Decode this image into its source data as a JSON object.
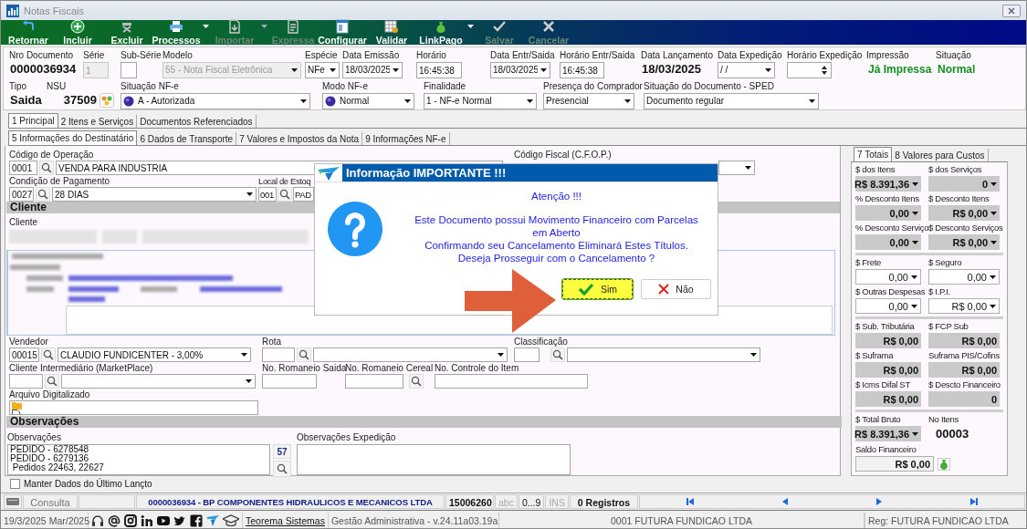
{
  "window": {
    "title": "Notas Fiscais"
  },
  "toolbar": [
    {
      "label": "Retornar",
      "disabled": false,
      "dropdown": false
    },
    {
      "label": "Incluir",
      "disabled": false,
      "dropdown": false
    },
    {
      "label": "Excluir",
      "disabled": false,
      "dropdown": false
    },
    {
      "label": "Processos",
      "disabled": false,
      "dropdown": true
    },
    {
      "label": "Importar",
      "disabled": true,
      "dropdown": true
    },
    {
      "label": "Expressa",
      "disabled": true,
      "dropdown": false
    },
    {
      "label": "Configurar",
      "disabled": false,
      "dropdown": false
    },
    {
      "label": "Validar",
      "disabled": false,
      "dropdown": false
    },
    {
      "label": "LinkPago",
      "disabled": false,
      "dropdown": true
    },
    {
      "label": "Salvar",
      "disabled": true,
      "dropdown": false
    },
    {
      "label": "Cancelar",
      "disabled": true,
      "dropdown": false
    }
  ],
  "header_top": [
    {
      "label": "Nro Documento",
      "value": "0000036934",
      "kind": "static",
      "disabled": false
    },
    {
      "label": "Série",
      "value": "1",
      "kind": "text",
      "disabled": true
    },
    {
      "label": "Sub-Série",
      "kind": "text",
      "disabled": false
    },
    {
      "label": "Modelo",
      "value": "55 - Nota Fiscal Eletrônica",
      "kind": "combo",
      "disabled": true
    },
    {
      "label": "Espécie",
      "value": "NFe",
      "kind": "combo",
      "disabled": false
    },
    {
      "label": "Data Emissão",
      "value": "18/03/2025",
      "kind": "combo",
      "disabled": false
    },
    {
      "label": "Horário",
      "value": "16:45:38",
      "kind": "text",
      "disabled": false
    },
    {
      "label": "Data Entr/Saida",
      "value": "18/03/2025",
      "kind": "combo",
      "disabled": false
    },
    {
      "label": "Horário Entr/Saida",
      "value": "16:45:38",
      "kind": "text",
      "disabled": false
    },
    {
      "label": "Data Lançamento",
      "value": "18/03/2025",
      "kind": "static",
      "disabled": false
    },
    {
      "label": "Data Expedição",
      "value": " / /",
      "kind": "combo",
      "disabled": false
    },
    {
      "label": "Horário Expedição",
      "kind": "spin",
      "disabled": false
    },
    {
      "label": "Impressão",
      "value": "Já Impressa",
      "kind": "status",
      "disabled": false
    },
    {
      "label": "Situação",
      "value": "Normal",
      "kind": "status",
      "disabled": false
    }
  ],
  "header_bottom": [
    {
      "label": "Tipo",
      "value": "Saida",
      "kind": "static",
      "disabled": false
    },
    {
      "label": "NSU",
      "value": "37509",
      "kind": "nsu",
      "disabled": false
    },
    {
      "label": "Situação NF-e",
      "value": "A - Autorizada",
      "kind": "dot-combo",
      "disabled": false
    },
    {
      "label": "Modo NF-e",
      "value": "Normal",
      "kind": "dot-combo",
      "disabled": false
    },
    {
      "label": "Finalidade",
      "value": "1 - NF-e Normal",
      "kind": "combo",
      "disabled": false
    },
    {
      "label": "Presença do Comprador",
      "value": "Presencial",
      "kind": "combo",
      "disabled": false
    },
    {
      "label": "Situação do Documento - SPED",
      "value": "Documento regular",
      "kind": "combo",
      "disabled": false
    }
  ],
  "tabs": [
    {
      "label": "1 Principal",
      "selected": true
    },
    {
      "label": "2 Itens e Serviços",
      "selected": false
    },
    {
      "label": "Documentos Referenciados",
      "selected": false
    }
  ],
  "subtabs": [
    {
      "label": "5 Informações do Destinatário",
      "selected": true
    },
    {
      "label": "6 Dados de Transporte",
      "selected": false
    },
    {
      "label": "7 Valores e Impostos da Nota",
      "selected": false
    },
    {
      "label": "9 Informações NF-e",
      "selected": false
    }
  ],
  "form": {
    "rows_top": [
      [
        {
          "label": "Código de Operação",
          "kind": "lookup-text",
          "code": "0001",
          "value": "VENDA PARA INDUSTRIA"
        },
        {
          "label": "Código Fiscal (C.F.O.P.)",
          "kind": "combo"
        }
      ],
      [
        {
          "label": "Condição de Pagamento",
          "kind": "lookup-combo",
          "code": "0027",
          "value": "28 DIAS"
        },
        {
          "label": "Local de Estoq",
          "kind": "lookup-text",
          "code": "001",
          "value": "PAD"
        }
      ]
    ],
    "cliente": {
      "title": "Cliente",
      "label": "Cliente"
    },
    "rows_bottom": [
      [
        {
          "label": "Vendedor",
          "kind": "lookup-combo",
          "code": "00015",
          "value": "CLAUDIO FUNDICENTER - 3,00%"
        },
        {
          "label": "Rota",
          "kind": "lookup-combo"
        },
        {
          "label": "Classificação",
          "kind": "lookup-combo"
        }
      ],
      [
        {
          "label": "Cliente Intermediário (MarketPlace)",
          "kind": "lookup-combo"
        },
        {
          "label": "No. Romaneio Saida",
          "kind": "text"
        },
        {
          "label": "No. Romaneio Cereal",
          "kind": "lookup-input"
        },
        {
          "label": "No. Controle do Item",
          "kind": "text"
        }
      ],
      [
        {
          "label": "Arquivo Digitalizado",
          "kind": "file"
        }
      ]
    ]
  },
  "observacoes": {
    "title": "Observações",
    "fields": [
      {
        "label": "Observações",
        "lines": [
          "PEDIDO - 6278548",
          "PEDIDO - 6279136",
          " Pedidos 22463, 22627"
        ],
        "counter": "57"
      },
      {
        "label": "Observações Expedição"
      }
    ]
  },
  "keep_data": {
    "label": "Manter Dados do Último Lançto",
    "checked": false
  },
  "totals": {
    "tabs": [
      {
        "label": "7 Totais",
        "selected": true
      },
      {
        "label": "8 Valores para Custos",
        "selected": false
      }
    ],
    "groups": [
      [
        {
          "label": "$ dos Itens",
          "value": "R$ 8.391,36",
          "kind": "combo"
        },
        {
          "label": "$ dos Serviços",
          "value": "0",
          "kind": "combo"
        },
        {
          "label": "% Desconto Itens",
          "value": "0,00",
          "kind": "combo"
        },
        {
          "label": "$ Desconto Itens",
          "value": "R$ 0,00",
          "kind": "combo"
        },
        {
          "label": "% Desconto Serviço",
          "value": "0,00",
          "kind": "combo"
        },
        {
          "label": "$ Desconto Serviços",
          "value": "R$ 0,00",
          "kind": "combo"
        }
      ],
      [
        {
          "label": "$ Frete",
          "value": "0,00",
          "kind": "input"
        },
        {
          "label": "$ Seguro",
          "value": "0,00",
          "kind": "input"
        },
        {
          "label": "$ Outras Despesas",
          "value": "0,00",
          "kind": "input"
        },
        {
          "label": "$ I.P.I.",
          "value": "R$ 0,00",
          "kind": "input"
        }
      ],
      [
        {
          "label": "$ Sub. Tributária",
          "value": "R$ 0,00",
          "kind": "total"
        },
        {
          "label": "$ FCP Sub",
          "value": "R$ 0,00",
          "kind": "total"
        },
        {
          "label": "$ Suframa",
          "value": "R$ 0,00",
          "kind": "total"
        },
        {
          "label": "Suframa PIS/Cofins",
          "value": "R$ 0,00",
          "kind": "total"
        },
        {
          "label": "$ Icms Difal ST",
          "value": "R$ 0,00",
          "kind": "total"
        },
        {
          "label": "$ Descto Financeiro",
          "value": "0",
          "kind": "total"
        }
      ],
      [
        {
          "label": "$ Total Bruto",
          "value": "R$ 8.391,36",
          "kind": "combo"
        },
        {
          "label": "No Itens",
          "value": "00003",
          "kind": "count"
        },
        {
          "label": "Saldo Financeiro",
          "value": "R$ 0,00",
          "kind": "balance"
        }
      ]
    ]
  },
  "dialog": {
    "title": "Informação IMPORTANTE !!!",
    "heading": "Atenção !!!",
    "lines": [
      "Este Documento possui Movimento Financeiro com Parcelas em Aberto",
      "Confirmando seu Cancelamento Eliminará Estes Títulos.",
      "Deseja Prosseguir com o Cancelamento ?"
    ],
    "buttons": [
      {
        "label": "Sim",
        "kind": "confirm",
        "selected": true
      },
      {
        "label": "Não",
        "kind": "cancel",
        "selected": false
      }
    ]
  },
  "status_bar": {
    "mode": "Consulta",
    "record": "0000036934 - BP COMPONENTES HIDRAULICOS E MECANICOS LTDA",
    "code": "15006260",
    "indicators": [
      {
        "label": "abc",
        "on": false
      },
      {
        "label": "0...9",
        "on": true
      },
      {
        "label": "INS",
        "on": false
      }
    ],
    "count": "0 Registros"
  },
  "footer": {
    "date": "19/3/2025 Mar/2025",
    "link": "Teorema Sistemas",
    "version": "Gestão Administrativa - v.24.11a03.19a",
    "company": "0001 FUTURA FUNDICAO LTDA",
    "region": "Reg: FUTURA FUNDICAO LTDA"
  }
}
